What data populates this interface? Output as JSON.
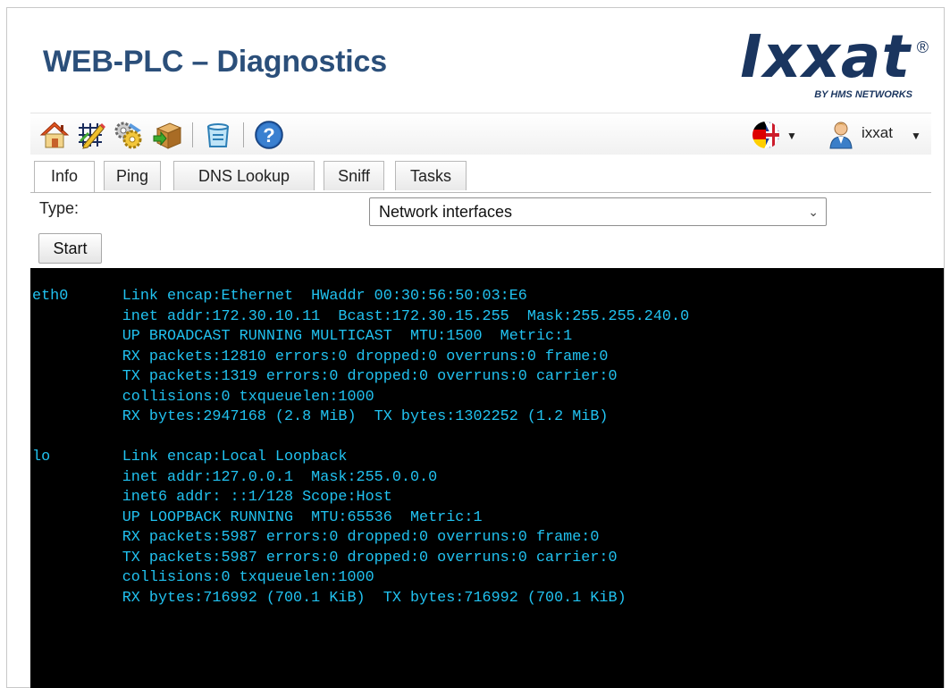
{
  "header": {
    "title": "WEB-PLC – Diagnostics",
    "logo": {
      "word": "Ixxat",
      "registered": "®",
      "tagline": "BY HMS NETWORKS",
      "color": "#1a355f"
    }
  },
  "toolbar": {
    "icons": [
      "home-icon",
      "grid-edit-icon",
      "gears-icon",
      "package-icon",
      "backup-box-icon",
      "help-icon"
    ],
    "language": {
      "icon": "german-british-flag-icon"
    },
    "user": {
      "name": "ixxat"
    }
  },
  "tabs": [
    {
      "label": "Info",
      "active": true
    },
    {
      "label": "Ping",
      "active": false
    },
    {
      "label": "DNS Lookup",
      "active": false
    },
    {
      "label": "Sniff",
      "active": false
    },
    {
      "label": "Tasks",
      "active": false
    }
  ],
  "form": {
    "type_label": "Type:",
    "type_value": "Network interfaces",
    "start_label": "Start"
  },
  "console": {
    "colors": {
      "background": "#000000",
      "text": "#21c2f0"
    },
    "text": "eth0      Link encap:Ethernet  HWaddr 00:30:56:50:03:E6\n          inet addr:172.30.10.11  Bcast:172.30.15.255  Mask:255.255.240.0\n          UP BROADCAST RUNNING MULTICAST  MTU:1500  Metric:1\n          RX packets:12810 errors:0 dropped:0 overruns:0 frame:0\n          TX packets:1319 errors:0 dropped:0 overruns:0 carrier:0\n          collisions:0 txqueuelen:1000\n          RX bytes:2947168 (2.8 MiB)  TX bytes:1302252 (1.2 MiB)\n\nlo        Link encap:Local Loopback\n          inet addr:127.0.0.1  Mask:255.0.0.0\n          inet6 addr: ::1/128 Scope:Host\n          UP LOOPBACK RUNNING  MTU:65536  Metric:1\n          RX packets:5987 errors:0 dropped:0 overruns:0 frame:0\n          TX packets:5987 errors:0 dropped:0 overruns:0 carrier:0\n          collisions:0 txqueuelen:1000\n          RX bytes:716992 (700.1 KiB)  TX bytes:716992 (700.1 KiB)"
  }
}
